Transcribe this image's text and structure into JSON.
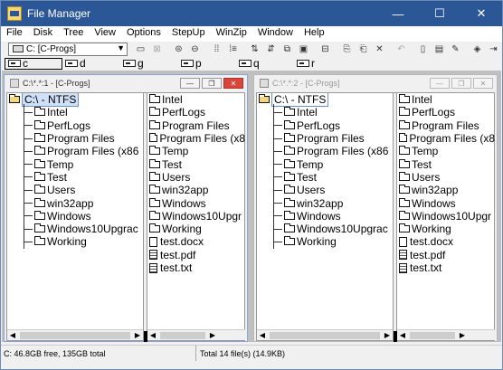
{
  "window": {
    "title": "File Manager",
    "controls": {
      "minimize": "—",
      "maximize": "☐",
      "close": "✕"
    }
  },
  "menu": [
    "File",
    "Disk",
    "Tree",
    "View",
    "Options",
    "StepUp",
    "WinZip",
    "Window",
    "Help"
  ],
  "toolbar": {
    "drive_select": "C: [C-Progs]",
    "buttons": [
      "net-drive-icon",
      "disconnect-icon",
      "share-icon",
      "unshare-icon",
      "view-icon",
      "view2-icon",
      "sort-icon",
      "sort2-icon",
      "copy-icon",
      "move-icon",
      "new-window-icon",
      "copy2-icon",
      "paste-icon",
      "delete-icon",
      "undo-icon",
      "new-file-icon",
      "props-icon",
      "edit-icon",
      "run-icon",
      "exit-icon"
    ]
  },
  "drives": [
    "c",
    "d",
    "g",
    "p",
    "q",
    "r"
  ],
  "panes": [
    {
      "title": "C:\\*.*:1 - [C-Progs]",
      "root": "C:\\ - NTFS",
      "tree": [
        "Intel",
        "PerfLogs",
        "Program Files",
        "Program Files (x86",
        "Temp",
        "Test",
        "Users",
        "win32app",
        "Windows",
        "Windows10Upgrac",
        "Working"
      ],
      "folders": [
        "Intel",
        "PerfLogs",
        "Program Files",
        "Program Files (x8",
        "Temp",
        "Test",
        "Users",
        "win32app",
        "Windows",
        "Windows10Upgr",
        "Working"
      ],
      "files": [
        "test.docx",
        "test.pdf",
        "test.txt"
      ]
    },
    {
      "title": "C:\\*.*:2 - [C-Progs]",
      "root": "C:\\ - NTFS",
      "tree": [
        "Intel",
        "PerfLogs",
        "Program Files",
        "Program Files (x86",
        "Temp",
        "Test",
        "Users",
        "win32app",
        "Windows",
        "Windows10Upgrac",
        "Working"
      ],
      "folders": [
        "Intel",
        "PerfLogs",
        "Program Files",
        "Program Files (x8",
        "Temp",
        "Test",
        "Users",
        "win32app",
        "Windows",
        "Windows10Upgr",
        "Working"
      ],
      "files": [
        "test.docx",
        "test.pdf",
        "test.txt"
      ]
    }
  ],
  "status": {
    "left": "C: 46.8GB free,  135GB total",
    "right": "Total 14 file(s) (14.9KB)"
  },
  "colors": {
    "titlebar": "#2b5797",
    "selection": "#cfe0f7"
  }
}
